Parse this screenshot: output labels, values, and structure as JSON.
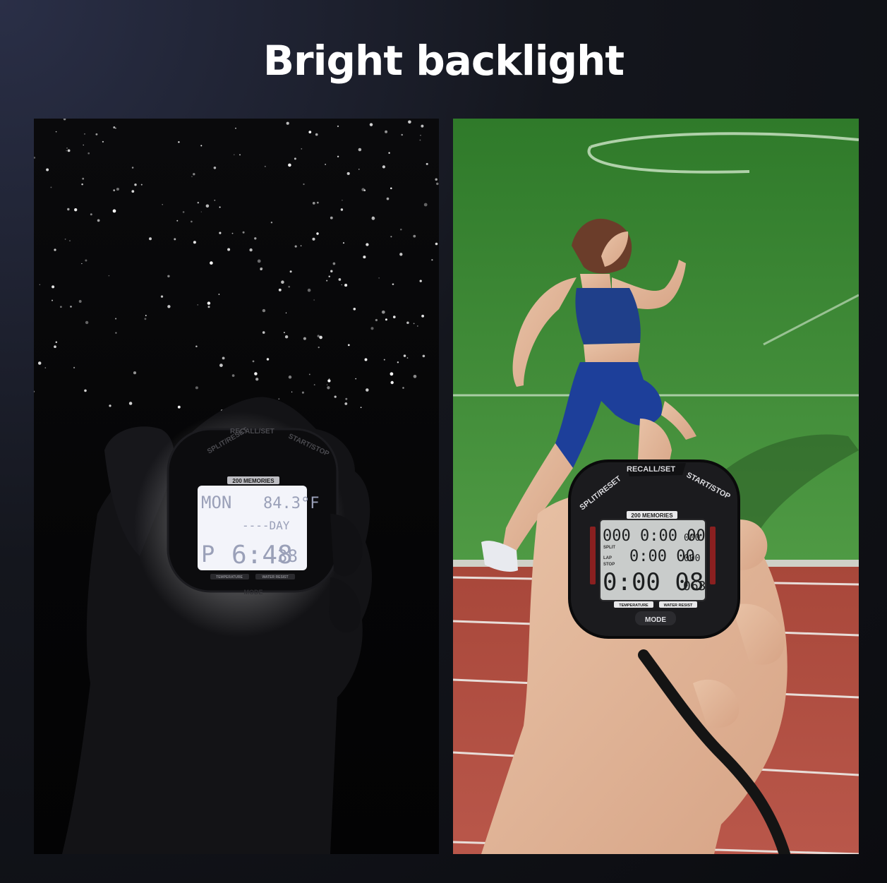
{
  "header": {
    "title": "Bright backlight"
  },
  "left_stopwatch": {
    "memories_label": "200 MEMORIES",
    "button_left": "SPLIT/RESET",
    "button_top": "RECALL/SET",
    "button_right": "START/STOP",
    "mode_label": "MODE",
    "temperature_label": "TEMPERATURE",
    "water_label": "WATER RESIST",
    "lcd": {
      "day": "MON",
      "temp": "84.3°F",
      "day_label": "----DAY",
      "am_pm": "P",
      "time": "6:48",
      "seconds": "38"
    }
  },
  "right_stopwatch": {
    "memories_label": "200 MEMORIES",
    "button_left": "SPLIT/RESET",
    "button_top": "RECALL/SET",
    "button_right": "START/STOP",
    "mode_label": "MODE",
    "temperature_label": "TEMPERATURE",
    "water_label": "WATER RESIST",
    "lcd": {
      "row1": "000 0:00 00",
      "row1_small": "000",
      "split_label": "SPLIT",
      "lap_label": "LAP",
      "stop_label": "STOP",
      "row2": "0:00 00",
      "row2_small": "000",
      "row3": "0:00 08",
      "row3_small": "063"
    }
  }
}
